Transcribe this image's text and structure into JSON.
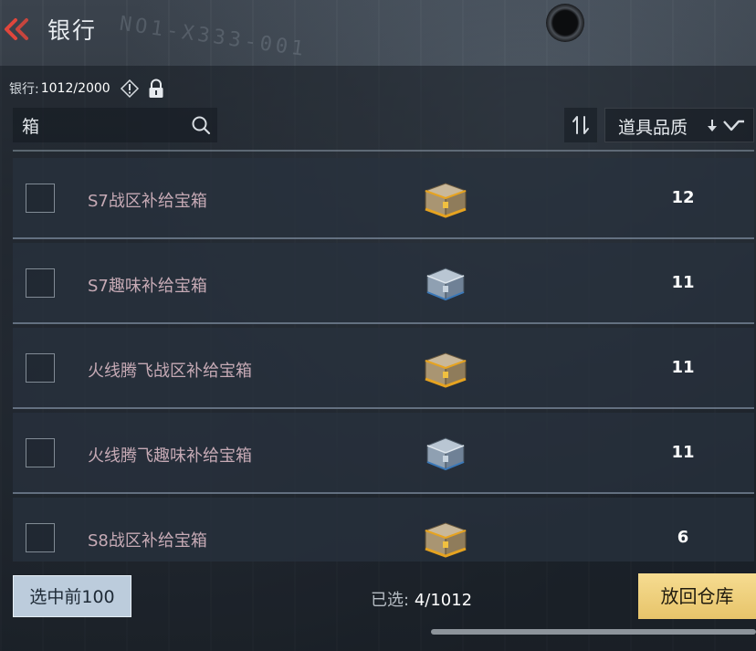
{
  "header": {
    "title": "银行",
    "back_icon": "double-chevron-left-icon",
    "accent": "#e0463c"
  },
  "bank": {
    "label": "银行:",
    "capacity": "1012/2000"
  },
  "search": {
    "value": "箱"
  },
  "filter": {
    "quality_label": "道具品质"
  },
  "items": [
    {
      "name": "S7战区补给宝箱",
      "count": "12",
      "icon": "gold-chest-icon"
    },
    {
      "name": "S7趣味补给宝箱",
      "count": "11",
      "icon": "silver-chest-icon"
    },
    {
      "name": "火线腾飞战区补给宝箱",
      "count": "11",
      "icon": "gold-chest-icon"
    },
    {
      "name": "火线腾飞趣味补给宝箱",
      "count": "11",
      "icon": "silver-chest-icon"
    },
    {
      "name": "S8战区补给宝箱",
      "count": "6",
      "icon": "gold-chest-icon"
    }
  ],
  "footer": {
    "select_top_label": "选中前100",
    "selected_label": "已选:",
    "selected_value": "4/1012",
    "return_label": "放回仓库"
  },
  "colors": {
    "item_name": "#c6aab5",
    "return_button": "#f0d17f",
    "select_button": "#bcccdc"
  }
}
